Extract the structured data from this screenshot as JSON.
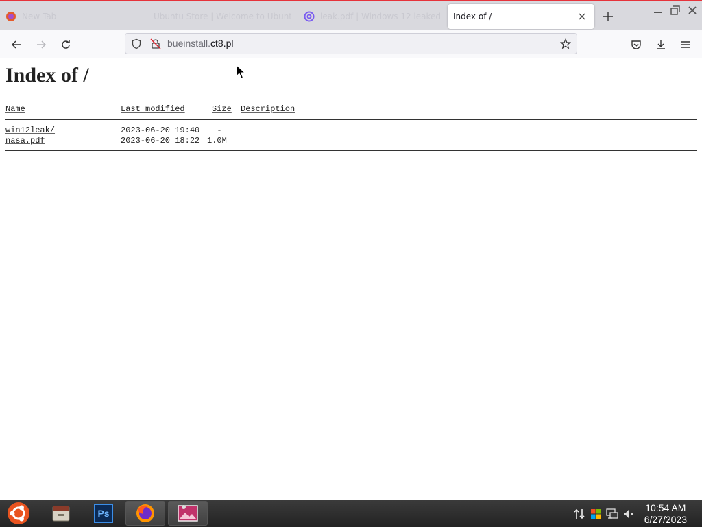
{
  "browser": {
    "tabs": [
      {
        "label": "New Tab",
        "active": false
      },
      {
        "label": "Ubuntu Store | Welcome to Ubuntu",
        "active": false
      },
      {
        "label": "leak.pdf | Windows 12 leaked",
        "active": false
      },
      {
        "label": "Index of /",
        "active": true
      }
    ],
    "url": {
      "host_dim": "bueinstall.",
      "host_main": "ct8.pl"
    }
  },
  "page": {
    "title": "Index of /",
    "columns": {
      "name": "Name",
      "last_modified": "Last modified",
      "size": "Size",
      "description": "Description"
    },
    "entries": [
      {
        "name": "win12leak/",
        "modified": "2023-06-20 19:40",
        "size": "  -"
      },
      {
        "name": "nasa.pdf",
        "modified": "2023-06-20 18:22",
        "size": "1.0M"
      }
    ]
  },
  "taskbar": {
    "apps": [
      "ubuntu-icon",
      "file-manager-icon",
      "photoshop-icon",
      "firefox-icon",
      "image-viewer-icon"
    ],
    "photoshop_label": "Ps",
    "clock": {
      "time": "10:54 AM",
      "date": "6/27/2023"
    }
  }
}
